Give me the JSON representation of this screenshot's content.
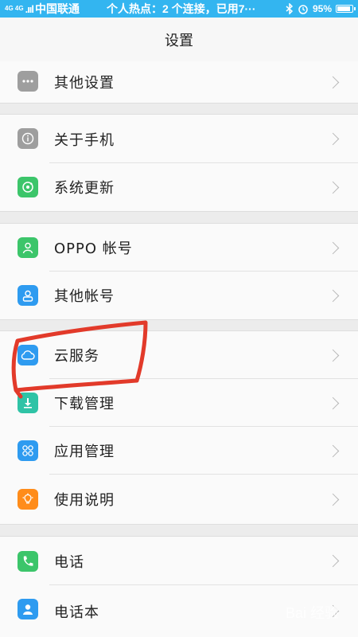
{
  "status_bar": {
    "network": "4G 4G",
    "signal": ".ııl",
    "carrier": "中国联通",
    "notification": "个人热点：2 个连接，已用7···",
    "battery_text": "95%",
    "battery_level": 0.95
  },
  "header": {
    "title": "设置"
  },
  "rows": [
    {
      "label": "其他设置",
      "icon": "more-dots-icon",
      "color": "#9e9e9e"
    },
    {
      "label": "关于手机",
      "icon": "info-icon",
      "color": "#9e9e9e"
    },
    {
      "label": "系统更新",
      "icon": "system-update-icon",
      "color": "#3cc56a"
    },
    {
      "label": "OPPO 帐号",
      "icon": "account-icon",
      "color": "#3cc56a"
    },
    {
      "label": "其他帐号",
      "icon": "user-icon",
      "color": "#2e9bf0"
    },
    {
      "label": "云服务",
      "icon": "cloud-icon",
      "color": "#2e9bf0"
    },
    {
      "label": "下载管理",
      "icon": "download-icon",
      "color": "#2fc3a6"
    },
    {
      "label": "应用管理",
      "icon": "apps-icon",
      "color": "#2e9bf0"
    },
    {
      "label": "使用说明",
      "icon": "lightbulb-icon",
      "color": "#ff8c1a"
    },
    {
      "label": "电话",
      "icon": "phone-icon",
      "color": "#3cc56a"
    },
    {
      "label": "电话本",
      "icon": "contacts-icon",
      "color": "#2e9bf0"
    }
  ],
  "watermark": "Bai 经验",
  "annotation_color": "#e23a2a"
}
